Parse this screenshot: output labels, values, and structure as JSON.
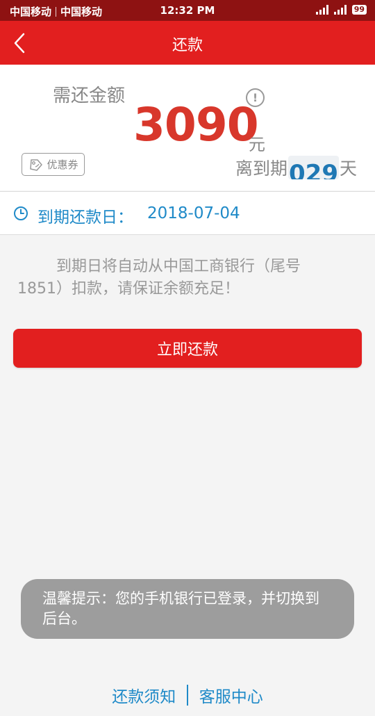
{
  "status_bar": {
    "carrier1": "中国移动",
    "carrier2": "中国移动",
    "time": "12:32 PM",
    "battery": "99"
  },
  "navbar": {
    "title": "还款",
    "back_icon": "chevron-left-icon"
  },
  "amount": {
    "label": "需还金额",
    "value": "3090",
    "unit": "元",
    "info_icon": "info-icon",
    "coupon_label": "优惠券",
    "coupon_icon": "coupon-icon",
    "days_prefix": "离到期",
    "days_value": "029",
    "days_suffix": "天"
  },
  "due": {
    "label": "到期还款日：",
    "date": "2018-07-04",
    "clock_icon": "clock-icon"
  },
  "notice": "到期日将自动从中国工商银行（尾号1851）扣款，请保证余额充足！",
  "pay_button": "立即还款",
  "toast": "温馨提示：您的手机银行已登录，并切换到后台。",
  "footer": {
    "link1": "还款须知",
    "link2": "客服中心"
  },
  "colors": {
    "status_bar": "#8e1212",
    "nav_bar": "#e21f1f",
    "amount": "#d8372b",
    "link_blue": "#1f8ac8"
  }
}
